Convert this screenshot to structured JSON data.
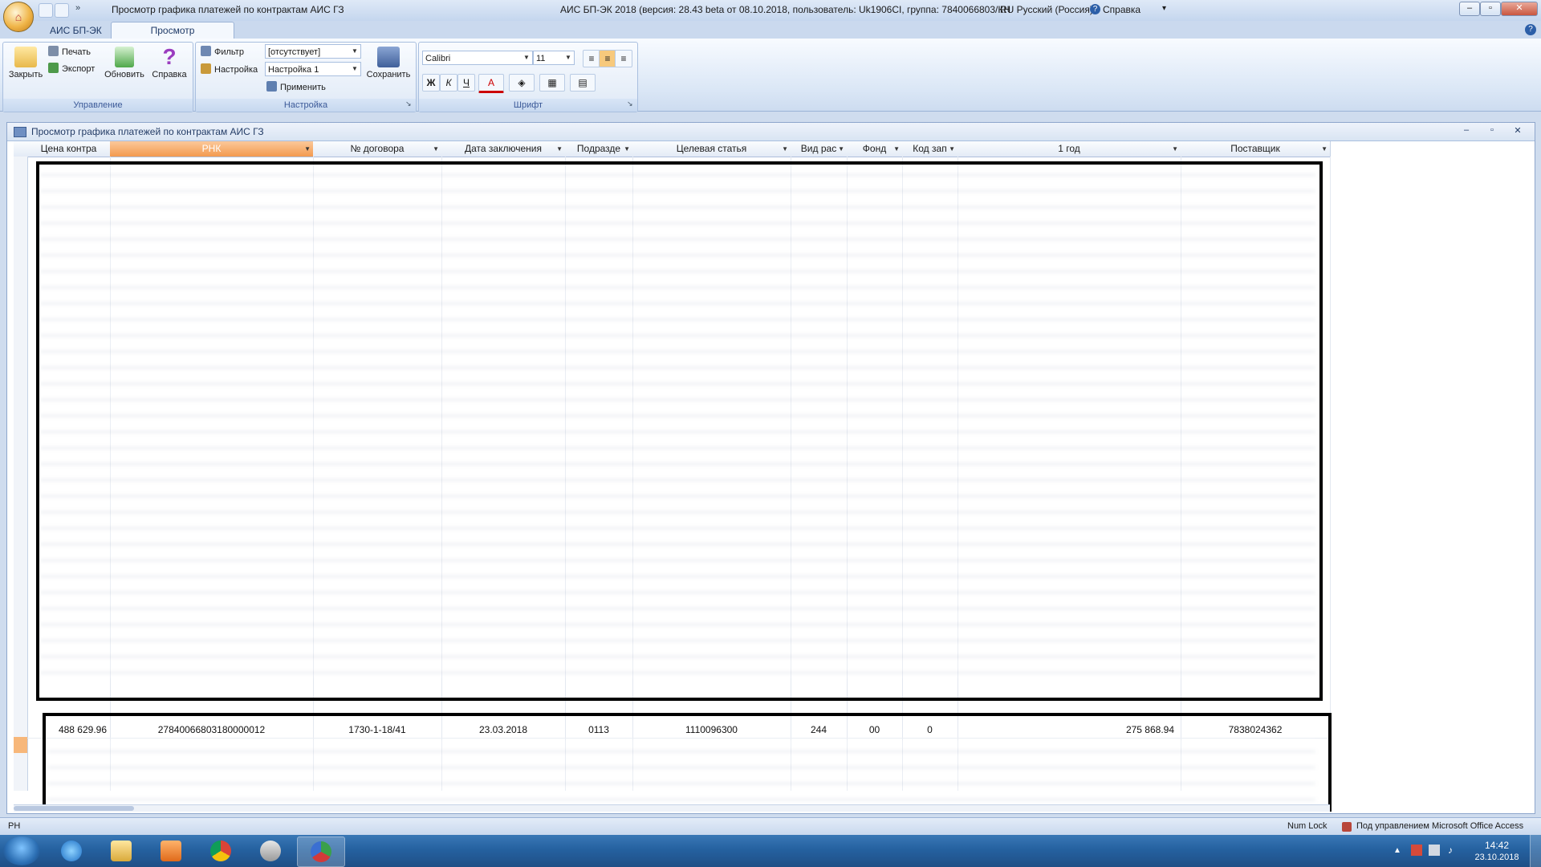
{
  "titlebar": {
    "doc_title": "Просмотр графика платежей по контрактам АИС ГЗ",
    "app_info": "АИС БП-ЭК 2018 (версия: 28.43 beta от 08.10.2018, пользователь: Uk1906CI, группа: 7840066803/КН",
    "language": "RU Русский (Россия)",
    "help": "Справка"
  },
  "ribbon": {
    "tabs": [
      "АИС БП-ЭК",
      "Просмотр"
    ],
    "group_manage": {
      "label": "Управление",
      "close": "Закрыть",
      "print": "Печать",
      "export": "Экспорт",
      "refresh": "Обновить",
      "help": "Справка"
    },
    "group_settings": {
      "label": "Настройка",
      "filter": "Фильтр",
      "filter_value": "[отсутствует]",
      "settings": "Настройка",
      "settings_value": "Настройка 1",
      "apply": "Применить",
      "save": "Сохранить"
    },
    "group_font": {
      "label": "Шрифт",
      "font_name": "Calibri",
      "font_size": "11",
      "bold": "Ж",
      "italic": "К",
      "underline": "Ч",
      "font_color": "A"
    }
  },
  "subwindow": {
    "title": "Просмотр графика платежей по контрактам АИС ГЗ"
  },
  "grid": {
    "columns": [
      "Цена контра",
      "РНК",
      "№ договора",
      "Дата заключения",
      "Подразде",
      "Целевая статья",
      "Вид рас",
      "Фонд",
      "Код зап",
      "1 год",
      "Поставщик"
    ],
    "visible_row": {
      "price": "488 629.96",
      "rnk": "27840066803180000012",
      "contract": "1730-1-18/41",
      "date": "23.03.2018",
      "division": "0113",
      "target": "1110096300",
      "expense_type": "244",
      "fund": "00",
      "code": "0",
      "year1": "275 868.94",
      "supplier": "7838024362"
    }
  },
  "statusbar": {
    "left": "РН",
    "numlock": "Num Lock",
    "office": "Под управлением Microsoft Office Access"
  },
  "taskbar": {
    "time": "14:42",
    "date": "23.10.2018"
  }
}
